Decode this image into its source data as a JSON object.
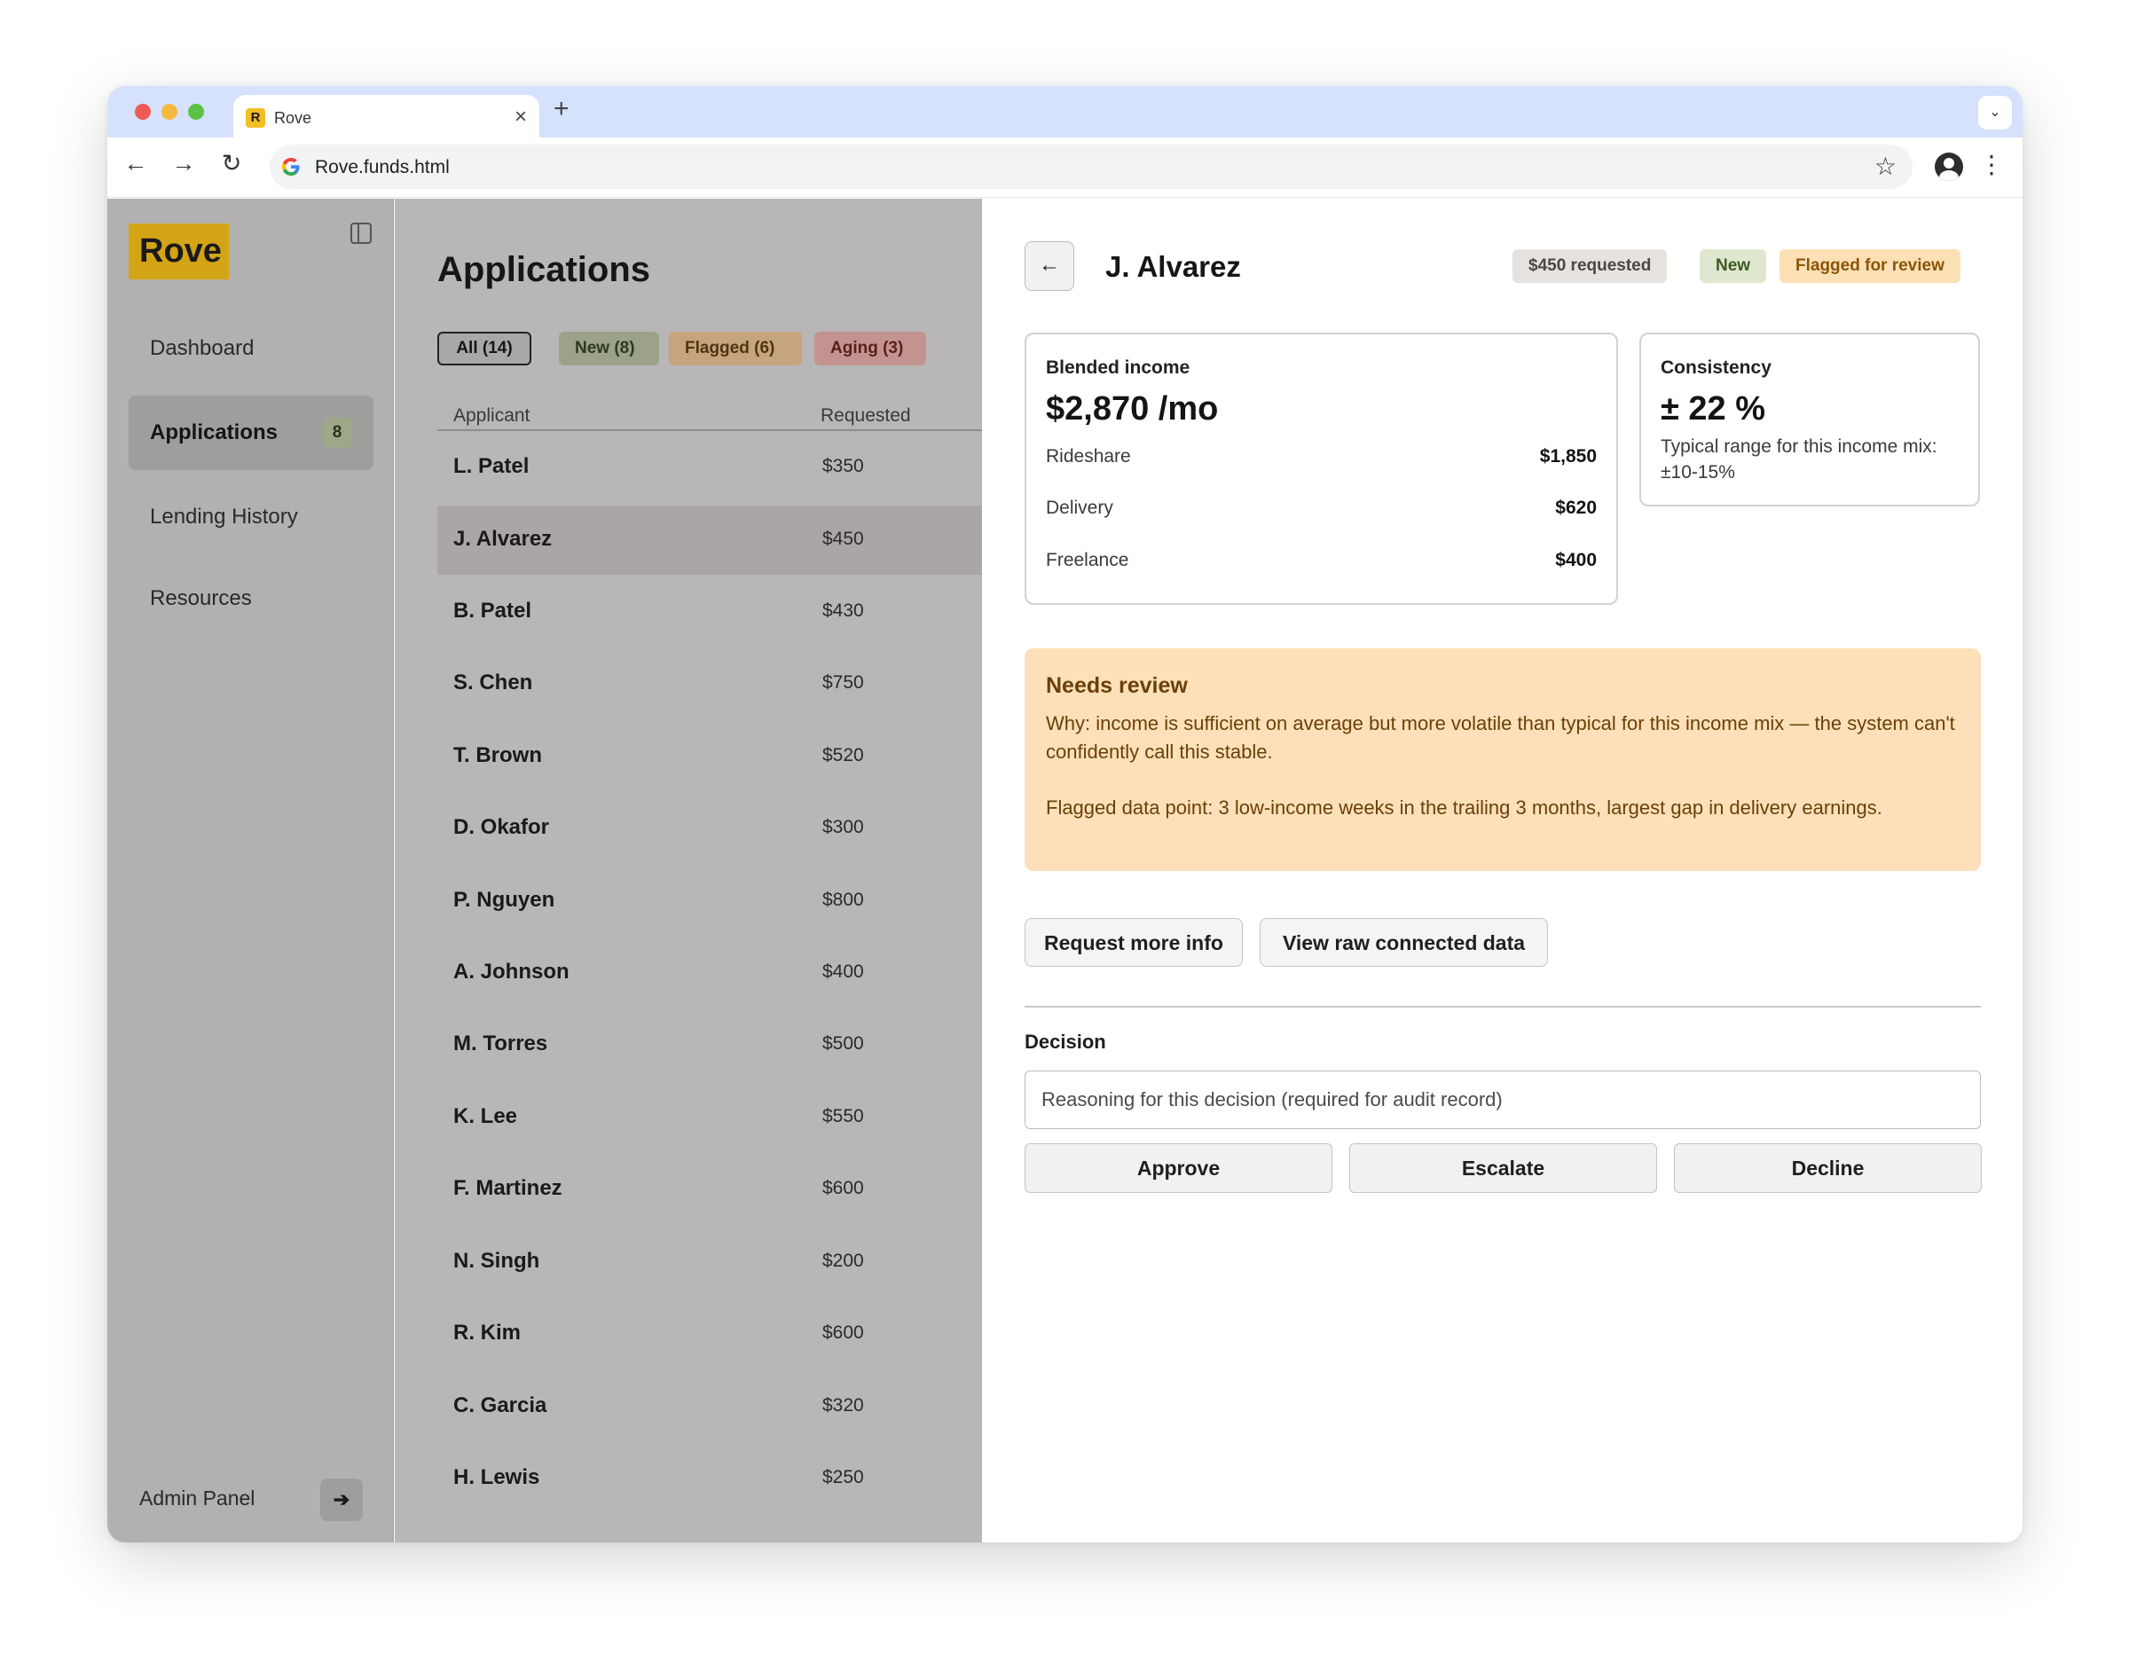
{
  "browser": {
    "tab_title": "Rove",
    "tab_favicon_letter": "R",
    "url": "Rove.funds.html"
  },
  "sidebar": {
    "logo": "Rove",
    "items": [
      {
        "label": "Dashboard"
      },
      {
        "label": "Applications",
        "badge": "8"
      },
      {
        "label": "Lending History"
      },
      {
        "label": "Resources"
      }
    ],
    "admin_label": "Admin Panel"
  },
  "list": {
    "title": "Applications",
    "filters": {
      "all": "All (14)",
      "new": "New (8)",
      "flagged": "Flagged (6)",
      "aging": "Aging (3)"
    },
    "columns": {
      "applicant": "Applicant",
      "requested": "Requested"
    },
    "rows": [
      {
        "name": "L. Patel",
        "amount": "$350"
      },
      {
        "name": "J. Alvarez",
        "amount": "$450"
      },
      {
        "name": "B. Patel",
        "amount": "$430"
      },
      {
        "name": "S. Chen",
        "amount": "$750"
      },
      {
        "name": "T. Brown",
        "amount": "$520"
      },
      {
        "name": "D. Okafor",
        "amount": "$300"
      },
      {
        "name": "P. Nguyen",
        "amount": "$800"
      },
      {
        "name": "A. Johnson",
        "amount": "$400"
      },
      {
        "name": "M. Torres",
        "amount": "$500"
      },
      {
        "name": "K. Lee",
        "amount": "$550"
      },
      {
        "name": "F. Martinez",
        "amount": "$600"
      },
      {
        "name": "N. Singh",
        "amount": "$200"
      },
      {
        "name": "R. Kim",
        "amount": "$600"
      },
      {
        "name": "C. Garcia",
        "amount": "$320"
      },
      {
        "name": "H. Lewis",
        "amount": "$250"
      }
    ]
  },
  "detail": {
    "name": "J. Alvarez",
    "pills": {
      "requested": "$450 requested",
      "status": "New",
      "flag": "Flagged for review"
    },
    "income": {
      "label": "Blended income",
      "value": "$2,870 /mo",
      "sources": [
        {
          "label": "Rideshare",
          "value": "$1,850"
        },
        {
          "label": "Delivery",
          "value": "$620"
        },
        {
          "label": "Freelance",
          "value": "$400"
        }
      ]
    },
    "consistency": {
      "label": "Consistency",
      "value": "± 22 %",
      "note": "Typical range for this income mix: ±10-15%"
    },
    "review": {
      "title": "Needs review",
      "why": "Why: income is sufficient on average but more volatile than typical for this income mix — the system can't confidently call this stable.",
      "flagged": "Flagged data point: 3 low-income weeks in the trailing 3 months, largest gap in delivery earnings."
    },
    "actions": {
      "request_info": "Request more info",
      "view_raw": "View raw connected data"
    },
    "decision": {
      "label": "Decision",
      "placeholder": "Reasoning for this decision (required for audit record)",
      "approve": "Approve",
      "escalate": "Escalate",
      "decline": "Decline"
    }
  }
}
